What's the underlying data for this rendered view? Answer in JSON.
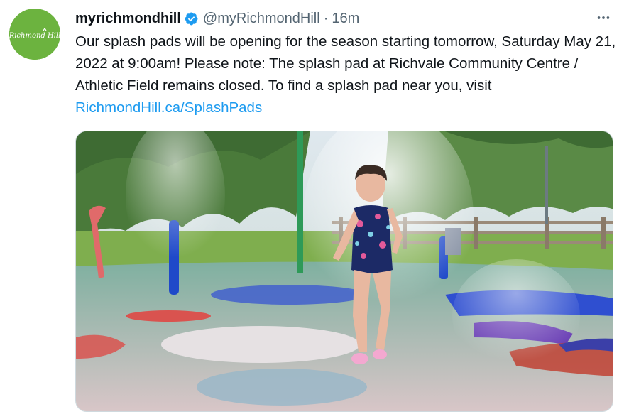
{
  "tweet": {
    "author": {
      "display_name": "myrichmondhill",
      "handle": "@myRichmondHill",
      "verified": true,
      "avatar_text": "Richmond Hill",
      "avatar_color": "#6cb33f"
    },
    "separator": "·",
    "timestamp": "16m",
    "more_icon": "more-horizontal-icon",
    "text_before_link": "Our splash pads will be opening for the season starting tomorrow, Saturday May 21, 2022 at 9:00am! Please note: The splash pad at Richvale Community Centre / Athletic Field remains closed. To find a splash pad near you, visit ",
    "link_text": "RichmondHill.ca/SplashPads",
    "media": {
      "type": "photo",
      "subject": "child running through splash pad water jets"
    }
  },
  "colors": {
    "link": "#1d9bf0",
    "secondary_text": "#536471",
    "verified_badge": "#1d9bf0"
  }
}
